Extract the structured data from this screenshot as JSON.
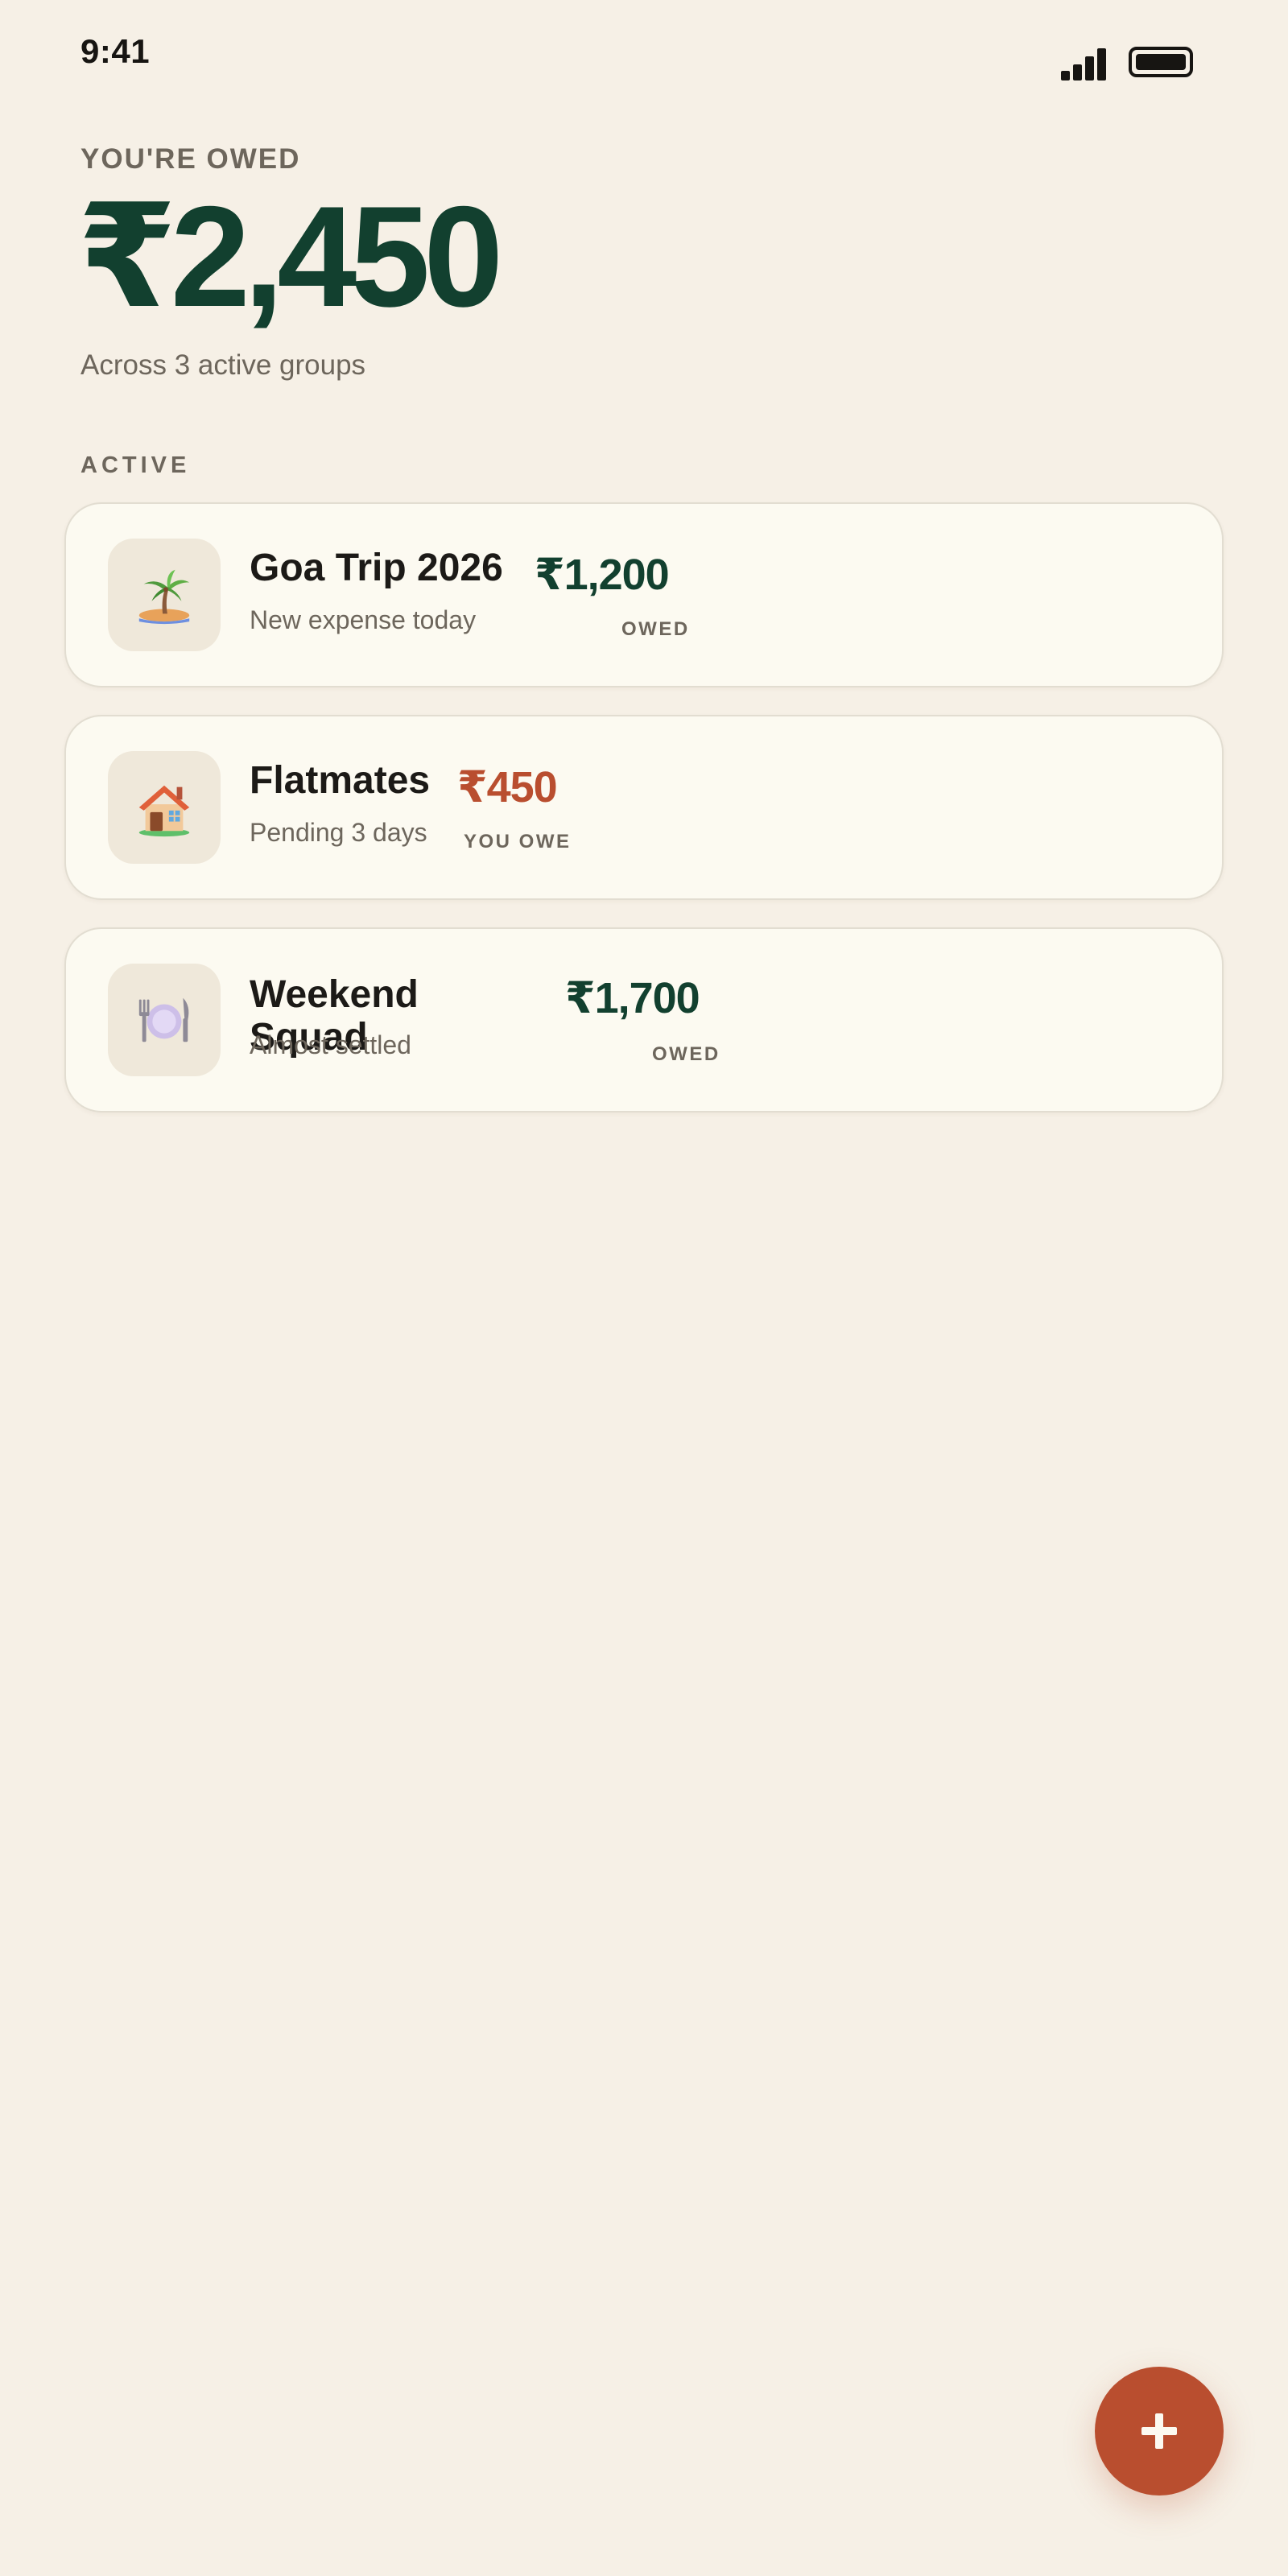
{
  "status_bar": {
    "time": "9:41"
  },
  "summary": {
    "label": "YOU'RE OWED",
    "amount": "₹2,450",
    "subtext": "Across 3 active groups"
  },
  "section": {
    "label": "ACTIVE"
  },
  "groups": [
    {
      "title": "Goa Trip 2026",
      "status": "New expense today",
      "amount": "₹1,200",
      "direction": "OWED",
      "icon": "palm-island-icon"
    },
    {
      "title": "Flatmates",
      "status": "Pending 3 days",
      "amount": "₹450",
      "direction": "YOU OWE",
      "icon": "house-icon"
    },
    {
      "title": "Weekend Squad",
      "status": "Almost settled",
      "amount": "₹1,700",
      "direction": "OWED",
      "icon": "fork-knife-plate-icon"
    }
  ],
  "colors": {
    "background": "#f6f0e6",
    "card": "#fcfaf1",
    "owed": "#12402f",
    "you_owe": "#b94e2f",
    "accent": "#b94e2f"
  },
  "fab": {
    "icon": "plus-icon"
  }
}
